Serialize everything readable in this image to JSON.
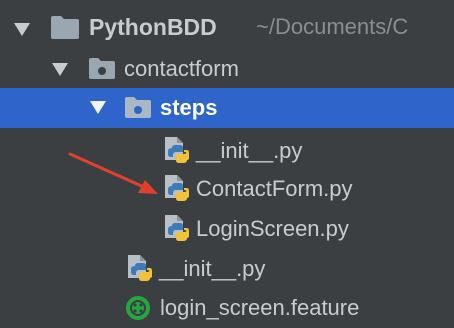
{
  "tree": {
    "root": {
      "name": "PythonBDD",
      "path_hint": "~/Documents/C",
      "expanded": true,
      "icon": "folder-icon"
    },
    "items": [
      {
        "label": "contactform",
        "icon": "package-folder-icon",
        "expanded": true
      },
      {
        "label": "steps",
        "icon": "package-folder-icon",
        "expanded": true,
        "selected": true
      },
      {
        "label": "__init__.py",
        "icon": "python-file-icon"
      },
      {
        "label": "ContactForm.py",
        "icon": "python-file-icon"
      },
      {
        "label": "LoginScreen.py",
        "icon": "python-file-icon"
      },
      {
        "label": "__init__.py",
        "icon": "python-file-icon"
      },
      {
        "label": "login_screen.feature",
        "icon": "cucumber-feature-icon"
      }
    ]
  },
  "colors": {
    "background": "#3c3f41",
    "selection": "#2f65ca",
    "text": "#c9ccce",
    "path_hint": "#8b8e90",
    "annotation_arrow": "#e0402e"
  }
}
